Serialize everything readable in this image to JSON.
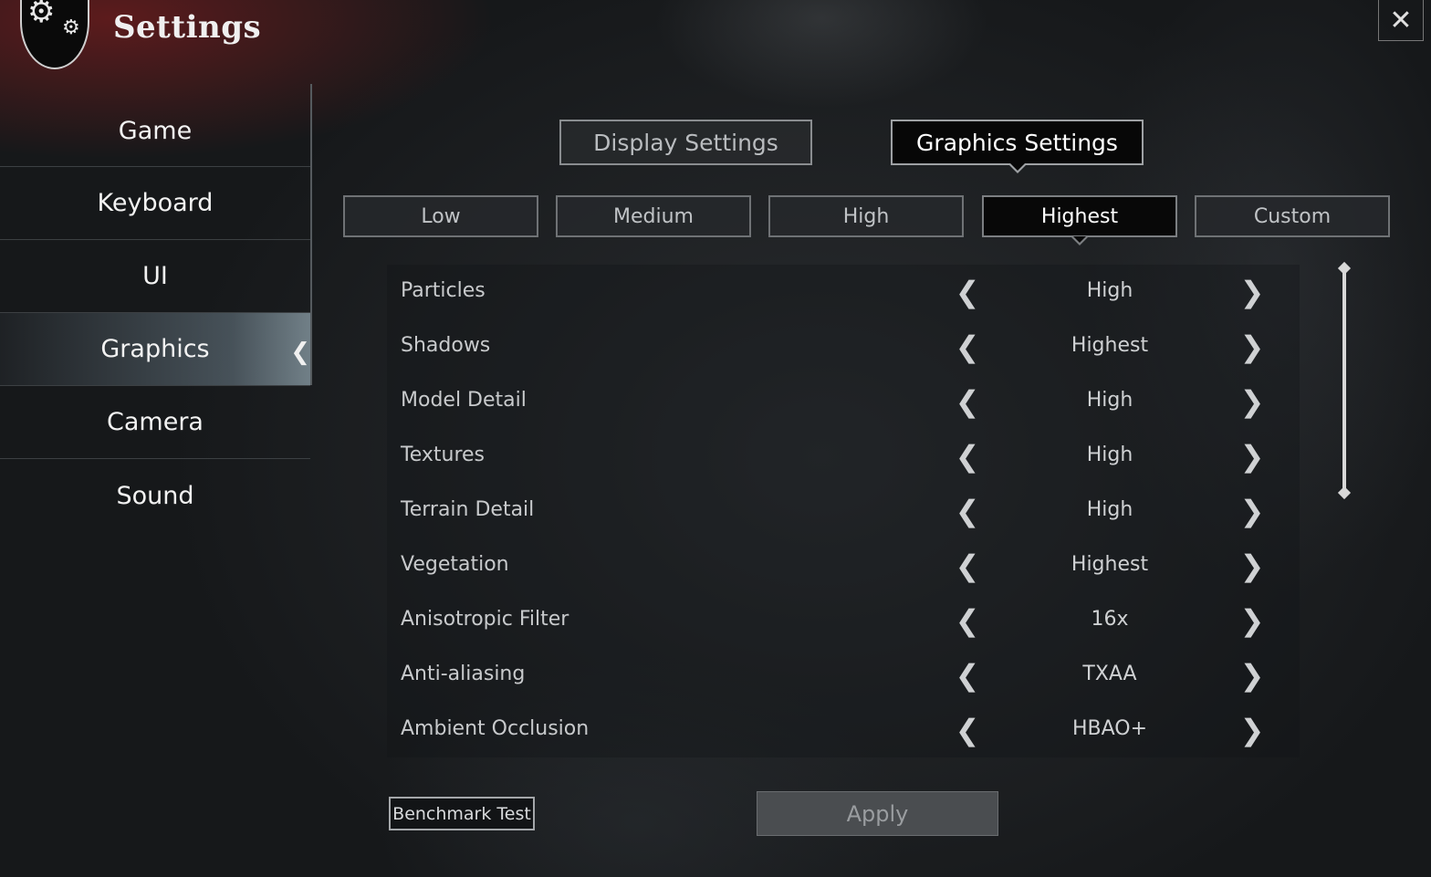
{
  "header": {
    "title": "Settings",
    "close_icon": "close-icon"
  },
  "sidebar": {
    "items": [
      {
        "label": "Game",
        "active": false
      },
      {
        "label": "Keyboard",
        "active": false
      },
      {
        "label": "UI",
        "active": false
      },
      {
        "label": "Graphics",
        "active": true
      },
      {
        "label": "Camera",
        "active": false
      },
      {
        "label": "Sound",
        "active": false
      }
    ]
  },
  "tabs": {
    "display_label": "Display Settings",
    "graphics_label": "Graphics Settings",
    "active": "Graphics Settings"
  },
  "presets": {
    "items": [
      "Low",
      "Medium",
      "High",
      "Highest",
      "Custom"
    ],
    "active": "Highest"
  },
  "settings": {
    "rows": [
      {
        "label": "Particles",
        "value": "High"
      },
      {
        "label": "Shadows",
        "value": "Highest"
      },
      {
        "label": "Model Detail",
        "value": "High"
      },
      {
        "label": "Textures",
        "value": "High"
      },
      {
        "label": "Terrain Detail",
        "value": "High"
      },
      {
        "label": "Vegetation",
        "value": "Highest"
      },
      {
        "label": "Anisotropic Filter",
        "value": "16x"
      },
      {
        "label": "Anti-aliasing",
        "value": "TXAA"
      },
      {
        "label": "Ambient Occlusion",
        "value": "HBAO+"
      }
    ]
  },
  "footer": {
    "benchmark_label": "Benchmark Test",
    "apply_label": "Apply"
  }
}
